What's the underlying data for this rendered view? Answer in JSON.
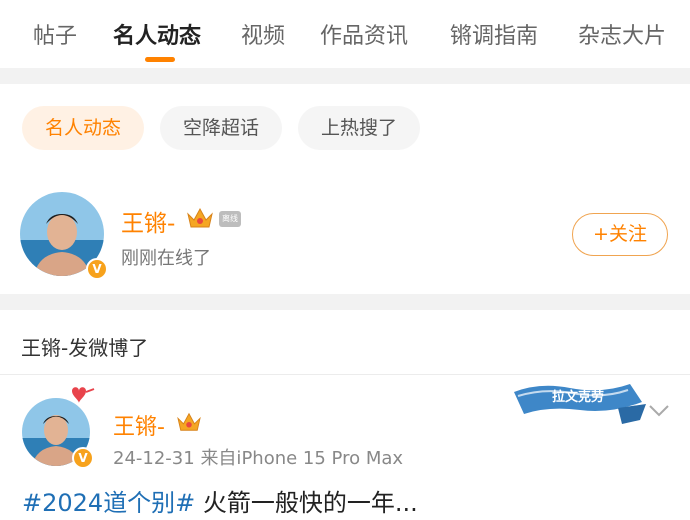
{
  "tabs": [
    {
      "label": "帖子",
      "active": false
    },
    {
      "label": "名人动态",
      "active": true
    },
    {
      "label": "视频",
      "active": false
    },
    {
      "label": "作品资讯",
      "active": false
    },
    {
      "label": "锵调指南",
      "active": false
    },
    {
      "label": "杂志大片",
      "active": false
    }
  ],
  "chips": [
    {
      "label": "名人动态",
      "active": true
    },
    {
      "label": "空降超话",
      "active": false
    },
    {
      "label": "上热搜了",
      "active": false
    }
  ],
  "celebrity": {
    "name": "王锵-",
    "offline_tag": "离线",
    "status": "刚刚在线了",
    "follow_label": "+关注",
    "verified_badge": "V"
  },
  "section": {
    "title": "王锵-发微博了"
  },
  "post": {
    "author": "王锵-",
    "date": "24-12-31",
    "source": "来自iPhone 15 Pro Max",
    "hashtag": "#2024道个别#",
    "text": " 火箭一般快的一年...",
    "ribbon_text": "拉文克劳",
    "verified_badge": "V"
  },
  "colors": {
    "accent": "#ff8200",
    "hashtag": "#1f6fb5",
    "chip_active_bg": "#fff1e4",
    "gap": "#f2f2f2"
  }
}
